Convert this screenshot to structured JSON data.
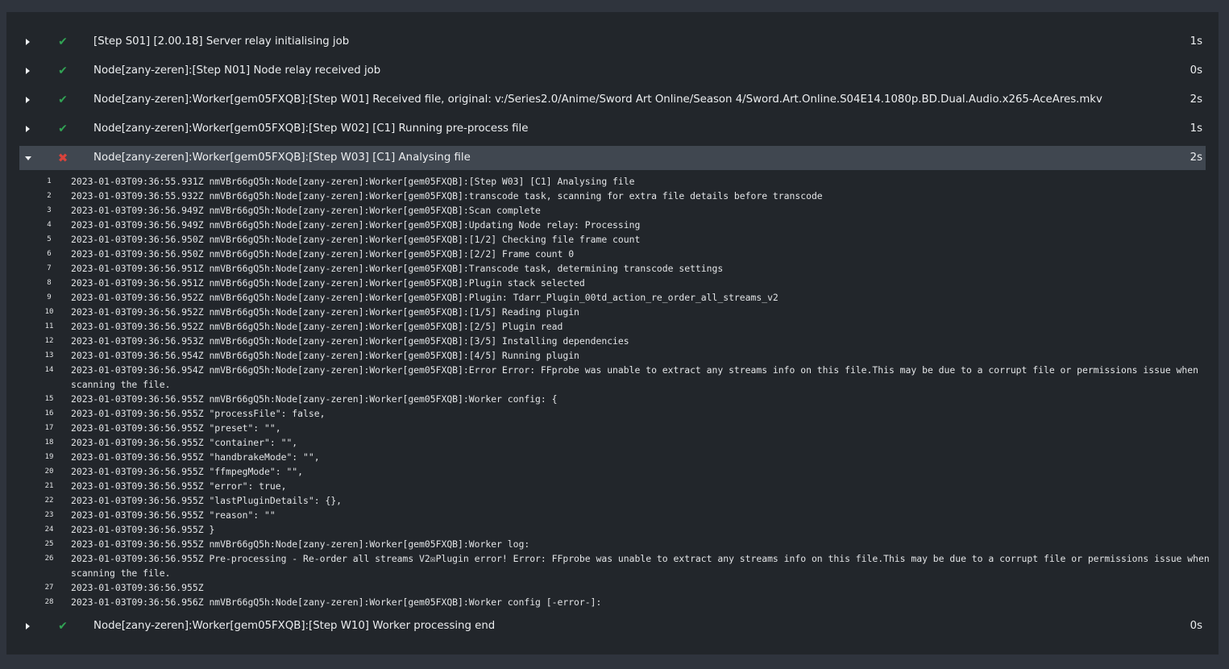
{
  "steps_before": [
    {
      "title": "[Step S01] [2.00.18] Server relay initialising job",
      "duration": "1s",
      "status": "success"
    },
    {
      "title": "Node[zany-zeren]:[Step N01] Node relay received job",
      "duration": "0s",
      "status": "success"
    },
    {
      "title": "Node[zany-zeren]:Worker[gem05FXQB]:[Step W01] Received file, original: v:/Series2.0/Anime/Sword Art Online/Season 4/Sword.Art.Online.S04E14.1080p.BD.Dual.Audio.x265-AceAres.mkv",
      "duration": "2s",
      "status": "success"
    },
    {
      "title": "Node[zany-zeren]:Worker[gem05FXQB]:[Step W02] [C1] Running pre-process file",
      "duration": "1s",
      "status": "success"
    }
  ],
  "expanded_step": {
    "title": "Node[zany-zeren]:Worker[gem05FXQB]:[Step W03] [C1] Analysing file",
    "duration": "2s",
    "status": "error",
    "log": [
      {
        "n": "1",
        "text": "2023-01-03T09:36:55.931Z nmVBr66gQ5h:Node[zany-zeren]:Worker[gem05FXQB]:[Step W03] [C1] Analysing file"
      },
      {
        "n": "2",
        "text": "2023-01-03T09:36:55.932Z nmVBr66gQ5h:Node[zany-zeren]:Worker[gem05FXQB]:transcode task, scanning for extra file details before transcode"
      },
      {
        "n": "3",
        "text": "2023-01-03T09:36:56.949Z nmVBr66gQ5h:Node[zany-zeren]:Worker[gem05FXQB]:Scan complete"
      },
      {
        "n": "4",
        "text": "2023-01-03T09:36:56.949Z nmVBr66gQ5h:Node[zany-zeren]:Worker[gem05FXQB]:Updating Node relay: Processing"
      },
      {
        "n": "5",
        "text": "2023-01-03T09:36:56.950Z nmVBr66gQ5h:Node[zany-zeren]:Worker[gem05FXQB]:[1/2] Checking file frame count"
      },
      {
        "n": "6",
        "text": "2023-01-03T09:36:56.950Z nmVBr66gQ5h:Node[zany-zeren]:Worker[gem05FXQB]:[2/2] Frame count 0"
      },
      {
        "n": "7",
        "text": "2023-01-03T09:36:56.951Z nmVBr66gQ5h:Node[zany-zeren]:Worker[gem05FXQB]:Transcode task, determining transcode settings"
      },
      {
        "n": "8",
        "text": "2023-01-03T09:36:56.951Z nmVBr66gQ5h:Node[zany-zeren]:Worker[gem05FXQB]:Plugin stack selected"
      },
      {
        "n": "9",
        "text": "2023-01-03T09:36:56.952Z nmVBr66gQ5h:Node[zany-zeren]:Worker[gem05FXQB]:Plugin: Tdarr_Plugin_00td_action_re_order_all_streams_v2"
      },
      {
        "n": "10",
        "text": "2023-01-03T09:36:56.952Z nmVBr66gQ5h:Node[zany-zeren]:Worker[gem05FXQB]:[1/5] Reading plugin"
      },
      {
        "n": "11",
        "text": "2023-01-03T09:36:56.952Z nmVBr66gQ5h:Node[zany-zeren]:Worker[gem05FXQB]:[2/5] Plugin read"
      },
      {
        "n": "12",
        "text": "2023-01-03T09:36:56.953Z nmVBr66gQ5h:Node[zany-zeren]:Worker[gem05FXQB]:[3/5] Installing dependencies"
      },
      {
        "n": "13",
        "text": "2023-01-03T09:36:56.954Z nmVBr66gQ5h:Node[zany-zeren]:Worker[gem05FXQB]:[4/5] Running plugin"
      },
      {
        "n": "14",
        "text": "2023-01-03T09:36:56.954Z nmVBr66gQ5h:Node[zany-zeren]:Worker[gem05FXQB]:Error Error: FFprobe was unable to extract any streams info on this file.This may be due to a corrupt file or permissions issue when scanning the file."
      },
      {
        "n": "15",
        "text": "2023-01-03T09:36:56.955Z nmVBr66gQ5h:Node[zany-zeren]:Worker[gem05FXQB]:Worker config: {"
      },
      {
        "n": "16",
        "text": "2023-01-03T09:36:56.955Z \"processFile\": false,"
      },
      {
        "n": "17",
        "text": "2023-01-03T09:36:56.955Z \"preset\": \"\","
      },
      {
        "n": "18",
        "text": "2023-01-03T09:36:56.955Z \"container\": \"\","
      },
      {
        "n": "19",
        "text": "2023-01-03T09:36:56.955Z \"handbrakeMode\": \"\","
      },
      {
        "n": "20",
        "text": "2023-01-03T09:36:56.955Z \"ffmpegMode\": \"\","
      },
      {
        "n": "21",
        "text": "2023-01-03T09:36:56.955Z \"error\": true,"
      },
      {
        "n": "22",
        "text": "2023-01-03T09:36:56.955Z \"lastPluginDetails\": {},"
      },
      {
        "n": "23",
        "text": "2023-01-03T09:36:56.955Z \"reason\": \"\""
      },
      {
        "n": "24",
        "text": "2023-01-03T09:36:56.955Z }"
      },
      {
        "n": "25",
        "text": "2023-01-03T09:36:56.955Z nmVBr66gQ5h:Node[zany-zeren]:Worker[gem05FXQB]:Worker log:"
      },
      {
        "n": "26",
        "text": "2023-01-03T09:36:56.955Z Pre-processing - Re-order all streams V2☒Plugin error! Error: FFprobe was unable to extract any streams info on this file.This may be due to a corrupt file or permissions issue when scanning the file."
      },
      {
        "n": "27",
        "text": "2023-01-03T09:36:56.955Z"
      },
      {
        "n": "28",
        "text": "2023-01-03T09:36:56.956Z nmVBr66gQ5h:Node[zany-zeren]:Worker[gem05FXQB]:Worker config [-error-]:"
      }
    ]
  },
  "steps_after": [
    {
      "title": "Node[zany-zeren]:Worker[gem05FXQB]:[Step W10] Worker processing end",
      "duration": "0s",
      "status": "success"
    }
  ],
  "icons": {
    "success": "check-icon",
    "error": "cross-icon",
    "collapsed": "caret-right-icon",
    "expanded": "caret-down-icon"
  },
  "colors": {
    "success": "#31a354",
    "error": "#d9433c",
    "panel": "#22262b",
    "expanded_header": "#404750"
  }
}
